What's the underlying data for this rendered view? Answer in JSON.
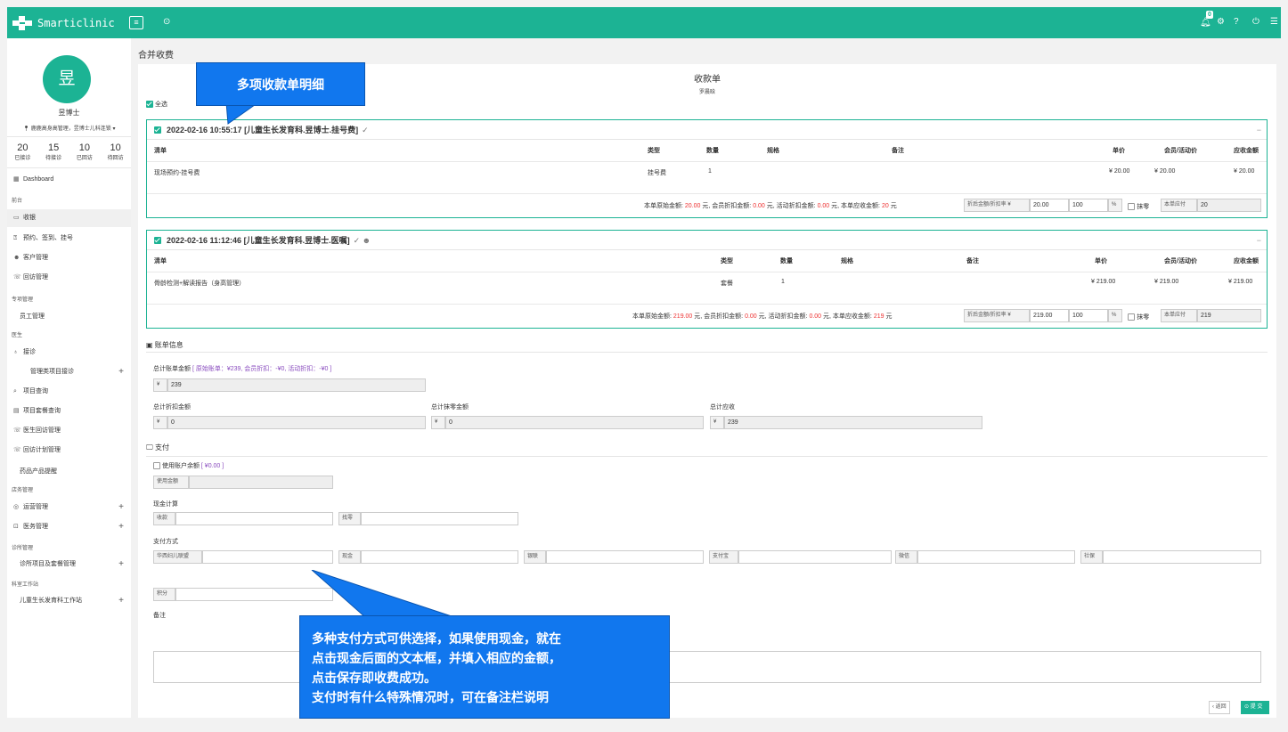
{
  "app": {
    "name": "Smarticlinic",
    "notification_count": "0"
  },
  "header_icons": [
    "menu-icon",
    "target-icon",
    "bell-icon",
    "gear-icon",
    "help-icon",
    "power-icon",
    "list-icon"
  ],
  "user": {
    "avatar_char": "昱",
    "name": "昱博士",
    "location": "鹿鹿高身高管理，昱博士儿科连锁"
  },
  "stats": [
    {
      "value": "20",
      "label": "已接诊"
    },
    {
      "value": "15",
      "label": "待接诊"
    },
    {
      "value": "10",
      "label": "已回访"
    },
    {
      "value": "10",
      "label": "待回访"
    }
  ],
  "nav": {
    "dashboard": "Dashboard",
    "sec_front": "前台",
    "charge": "收银",
    "booking": "预约、签到、挂号",
    "customers": "客户管理",
    "followup": "回访管理",
    "sec_admin": "专项管理",
    "staff": "员工管理",
    "sec_doctor": "医生",
    "reception": "接诊",
    "mgmt_reception": "管理类项目接诊",
    "item_query": "项目查询",
    "package_query": "项目套餐查询",
    "doctor_followup": "医生回访管理",
    "plan_followup": "回访计划管理",
    "drug_reminder": "药品产品提醒",
    "sec_store": "店务管理",
    "operations": "运营管理",
    "medical": "医务管理",
    "sec_clinic": "诊所管理",
    "clinic_items": "诊所项目及套餐管理",
    "sec_dept": "科室工作站",
    "child_station": "儿童生长发育科工作站"
  },
  "page": {
    "title": "合并收费",
    "receipt_title": "收款单",
    "patient": "罗晨晗",
    "select_all": "全选"
  },
  "orders": [
    {
      "header": "2022-02-16 10:55:17  [儿童生长发育科.昱博士.挂号费]",
      "icons": "✓",
      "columns": [
        "清单",
        "类型",
        "数量",
        "规格",
        "备注",
        "单价",
        "会员/活动价",
        "应收金额"
      ],
      "row": {
        "item": "现场预约-挂号费",
        "type": "挂号费",
        "qty": "1",
        "spec": "",
        "note": "",
        "price": "¥ 20.00",
        "member_price": "¥ 20.00",
        "due": "¥ 20.00"
      },
      "summary": {
        "p1": "本单原始金额:",
        "orig": "20.00",
        "p2": "元, 会员折扣金额:",
        "mdisc": "0.00",
        "p3": "元, 活动折扣金额:",
        "adisc": "0.00",
        "p4": "元, 本单应收金额:",
        "due": "20",
        "p5": "元"
      },
      "discount_label": "折后金额/折扣率 ¥",
      "discount_amount": "20.00",
      "discount_rate": "100",
      "percent": "%",
      "round_label": "抹零",
      "pay_label": "本单应付",
      "pay_value": "20",
      "minimize": "−"
    },
    {
      "header": "2022-02-16 11:12:46  [儿童生长发育科.昱博士.医嘱]",
      "icons": "✓ ☻",
      "columns": [
        "清单",
        "类型",
        "数量",
        "规格",
        "备注",
        "单价",
        "会员/活动价",
        "应收金额"
      ],
      "row": {
        "item": "骨龄检测+解读报告（身高管理）",
        "type": "套餐",
        "qty": "1",
        "spec": "",
        "note": "",
        "price": "¥ 219.00",
        "member_price": "¥ 219.00",
        "due": "¥ 219.00"
      },
      "summary": {
        "p1": "本单原始金额:",
        "orig": "219.00",
        "p2": "元, 会员折扣金额:",
        "mdisc": "0.00",
        "p3": "元, 活动折扣金额:",
        "adisc": "0.00",
        "p4": "元, 本单应收金额:",
        "due": "219",
        "p5": "元"
      },
      "discount_label": "折后金额/折扣率 ¥",
      "discount_amount": "219.00",
      "discount_rate": "100",
      "percent": "%",
      "round_label": "抹零",
      "pay_label": "本单应付",
      "pay_value": "219",
      "minimize": "−"
    }
  ],
  "bill": {
    "section": "账单信息",
    "total_label": "总计账单金额",
    "total_detail": "[ 原始账单：¥239,   会员折扣：-¥0,   活动折扣：-¥0 ]",
    "total_value": "239",
    "disc_label": "总计折扣金额",
    "disc_value": "0",
    "round_label": "总计抹零金额",
    "round_value": "0",
    "due_label": "总计应收",
    "due_value": "239",
    "currency": "¥"
  },
  "payment": {
    "section": "支付",
    "use_balance": "使用账户余额",
    "balance": "[ ¥0.00 ]",
    "use_amount": "使用金额",
    "cash_calc": "现金计算",
    "receive": "收款",
    "change": "找零",
    "methods_label": "支付方式",
    "methods": [
      "华西妇儿联盟",
      "现金",
      "银联",
      "支付宝",
      "微信",
      "社保"
    ],
    "points": "积分",
    "remark": "备注"
  },
  "buttons": {
    "back": "‹ 返回",
    "submit": "⊙ 提 交"
  },
  "callouts": {
    "c1": "多项收款单明细",
    "c2_lines": [
      "多种支付方式可供选择，如果使用现金，就在",
      "点击现金后面的文本框，并填入相应的金额，",
      "点击保存即收费成功。",
      "支付时有什么特殊情况时，可在备注栏说明"
    ]
  }
}
